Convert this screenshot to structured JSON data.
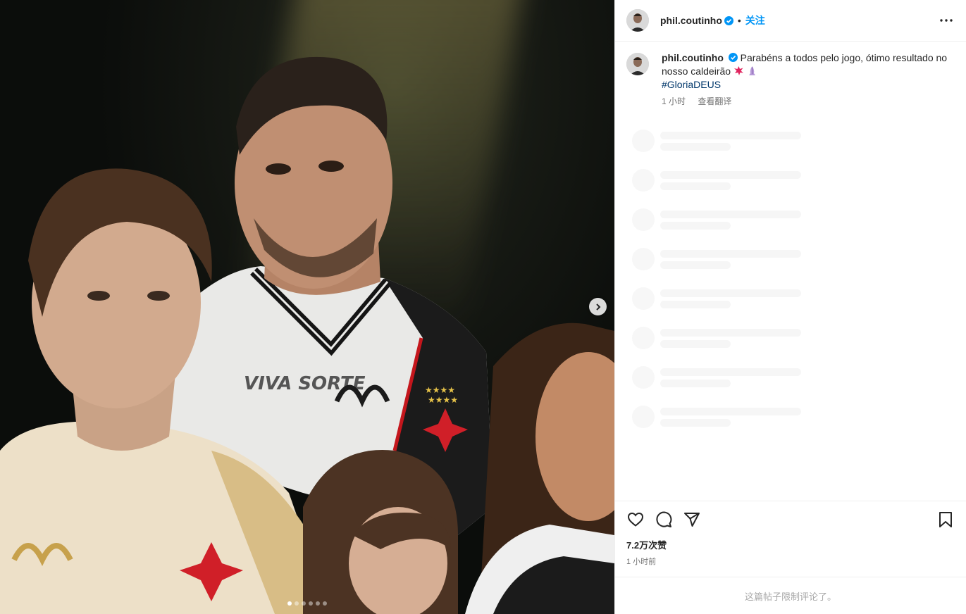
{
  "post": {
    "username": "phil.coutinho",
    "separator": "•",
    "follow_label": "关注",
    "caption": "Parabéns a todos pelo jogo, ótimo resultado no nosso caldeirão",
    "hashtag": "#GloriaDEUS",
    "caption_time": "1 小时",
    "translate_label": "查看翻译",
    "likes": "7.2万次赞",
    "time_ago": "1 小时前",
    "comments_limited": "这篇帖子限制评论了。"
  },
  "media": {
    "slide_count": 6,
    "active_slide": 1,
    "jersey_sponsor": "VIVA SORTE"
  },
  "icons": {
    "verified": "verified-badge-icon",
    "more": "more-options-icon",
    "like": "heart-icon",
    "comment": "comment-icon",
    "share": "send-icon",
    "save": "bookmark-icon",
    "next": "chevron-right-icon"
  },
  "colors": {
    "accent": "#0095f6",
    "hashtag": "#00376b",
    "muted": "#737373"
  }
}
